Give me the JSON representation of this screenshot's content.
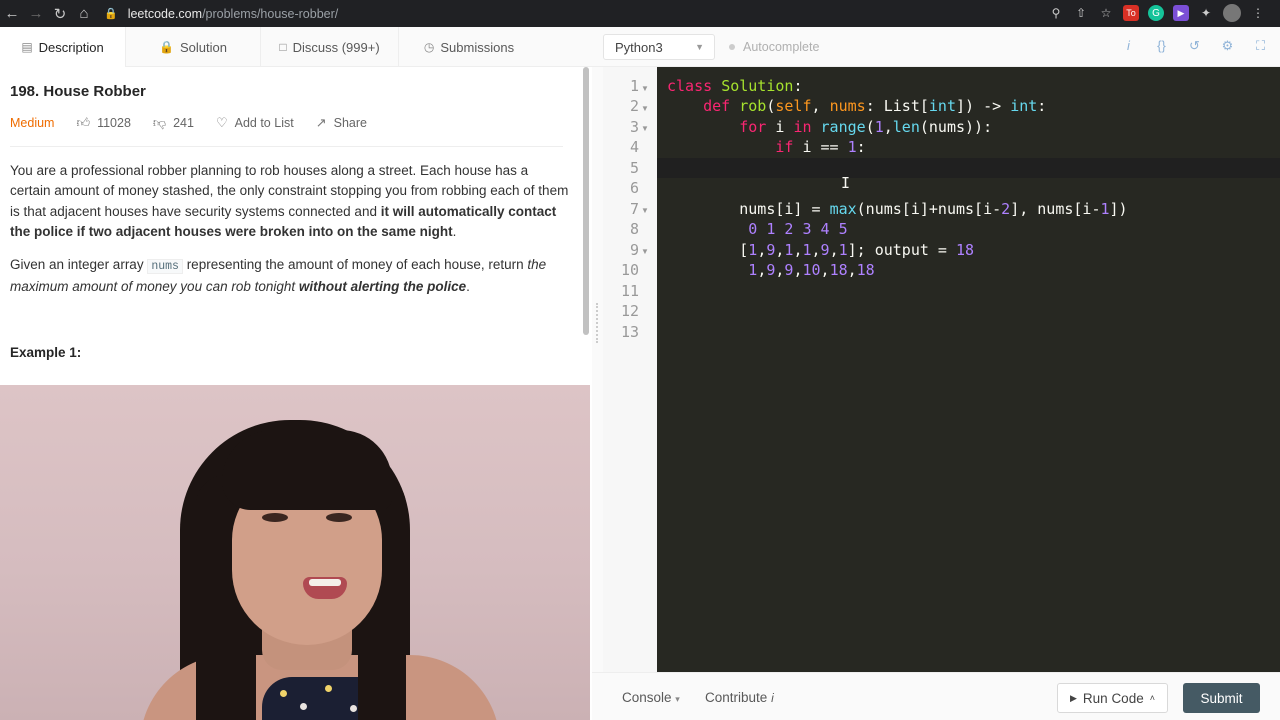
{
  "browser": {
    "url_host": "leetcode.com",
    "url_path": "/problems/house-robber/"
  },
  "tabs": [
    {
      "label": "Description"
    },
    {
      "label": "Solution"
    },
    {
      "label": "Discuss (999+)"
    },
    {
      "label": "Submissions"
    }
  ],
  "problem": {
    "title": "198. House Robber",
    "difficulty": "Medium",
    "likes": "11028",
    "dislikes": "241",
    "add_to_list": "Add to List",
    "share": "Share",
    "para1_part1": "You are a professional robber planning to rob houses along a street. Each house has a certain amount of money stashed, the only constraint stopping you from robbing each of them is that adjacent houses have security systems connected and ",
    "para1_bold": "it will automatically contact the police if two adjacent houses were broken into on the same night",
    "para1_end": ".",
    "para2_part1": "Given an integer array ",
    "para2_code": "nums",
    "para2_part2": " representing the amount of money of each house, return ",
    "para2_italic": "the maximum amount of money you can rob tonight ",
    "para2_bold_italic": "without alerting the police",
    "para2_end": ".",
    "example_heading": "Example 1:"
  },
  "editor": {
    "language": "Python3",
    "autocomplete": "Autocomplete",
    "line_numbers": [
      "1",
      "2",
      "3",
      "4",
      "5",
      "6",
      "7",
      "8",
      "9",
      "10",
      "11",
      "12",
      "13"
    ]
  },
  "bottom_bar": {
    "console": "Console",
    "contribute": "Contribute",
    "run_code": "Run Code",
    "submit": "Submit"
  }
}
